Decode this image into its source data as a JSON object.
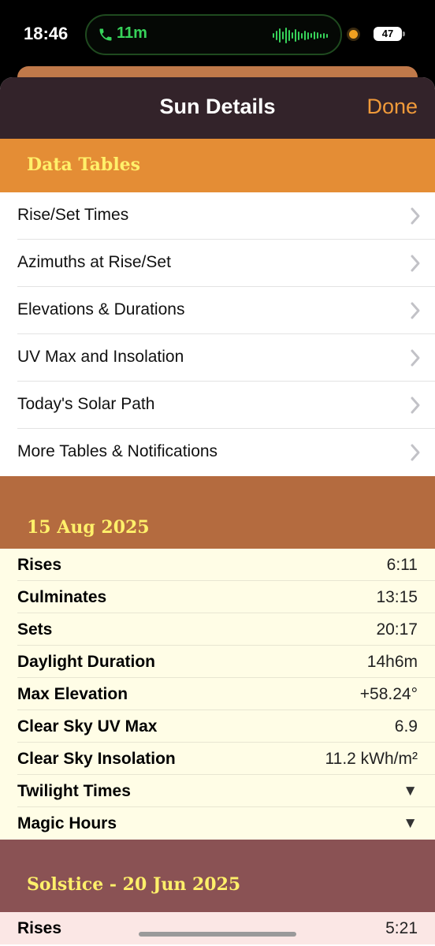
{
  "status_bar": {
    "time": "18:46",
    "call_duration": "11m",
    "battery": "47"
  },
  "nav": {
    "title": "Sun Details",
    "done_label": "Done"
  },
  "data_tables": {
    "header": "Data Tables",
    "items": [
      {
        "label": "Rise/Set Times"
      },
      {
        "label": "Azimuths at Rise/Set"
      },
      {
        "label": "Elevations & Durations"
      },
      {
        "label": "UV Max and Insolation"
      },
      {
        "label": "Today's Solar Path"
      },
      {
        "label": "More Tables & Notifications"
      }
    ]
  },
  "today": {
    "header": "15 Aug 2025",
    "rows": [
      {
        "key": "Rises",
        "value": "6:11"
      },
      {
        "key": "Culminates",
        "value": "13:15"
      },
      {
        "key": "Sets",
        "value": "20:17"
      },
      {
        "key": "Daylight Duration",
        "value": "14h6m"
      },
      {
        "key": "Max Elevation",
        "value": "+58.24°"
      },
      {
        "key": "Clear Sky UV Max",
        "value": "6.9"
      },
      {
        "key": "Clear Sky Insolation",
        "value": "11.2 kWh/m²"
      },
      {
        "key": "Twilight Times",
        "value": "▼"
      },
      {
        "key": "Magic Hours",
        "value": "▼"
      }
    ]
  },
  "solstice": {
    "header": "Solstice - 20 Jun 2025",
    "rows": [
      {
        "key": "Rises",
        "value": "5:21"
      }
    ]
  },
  "colors": {
    "nav_bg": "#33232a",
    "accent_done": "#f09a3a",
    "header_orange": "#e48d35",
    "header_brown": "#b46b3f",
    "header_plum": "#8a5254",
    "header_text": "#fff06a",
    "today_bg": "#fffde6",
    "solstice_bg": "#fbe7e5"
  }
}
